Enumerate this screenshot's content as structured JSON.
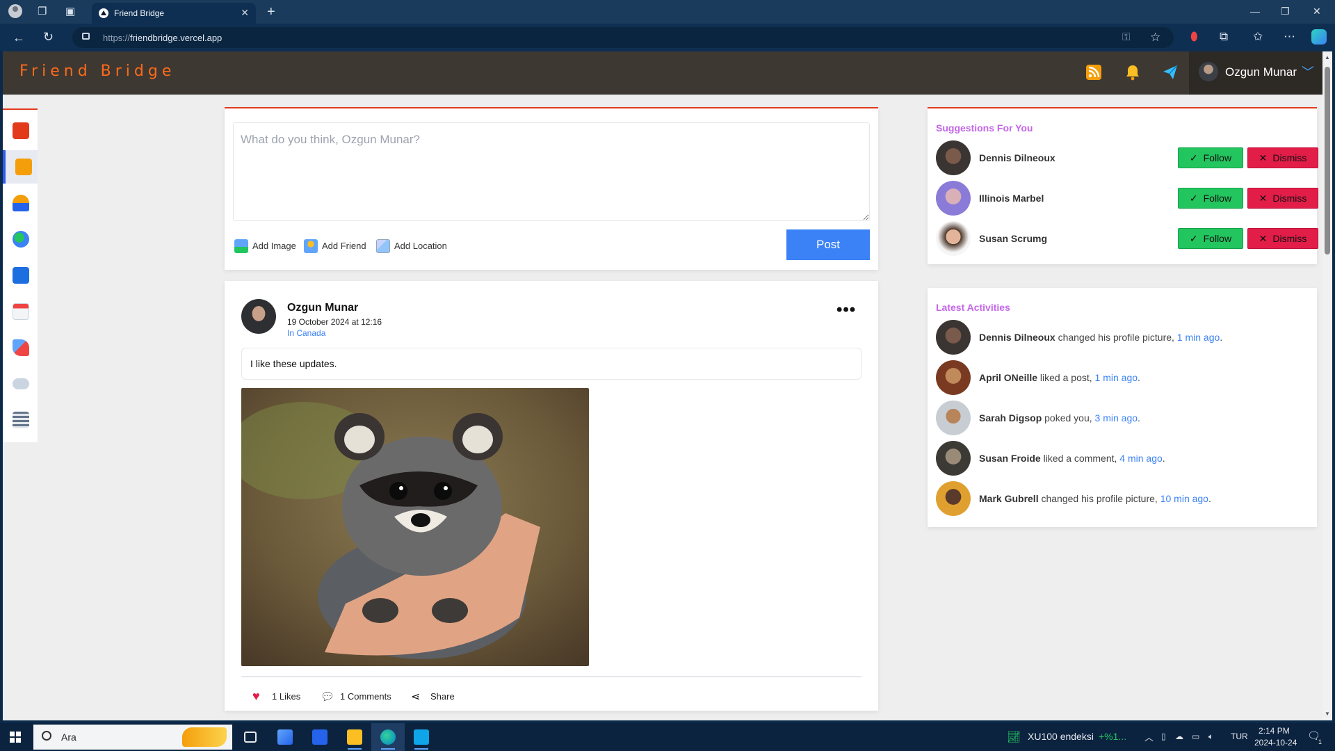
{
  "browser": {
    "tab_title": "Friend Bridge",
    "url_prefix": "https://",
    "url_host": "friendbridge.vercel.app"
  },
  "app": {
    "brand": "Friend Bridge",
    "user_name": "Ozgun Munar"
  },
  "composer": {
    "placeholder": "What do you think, Ozgun Munar?",
    "actions": [
      "Add Image",
      "Add Friend",
      "Add Location"
    ],
    "post_label": "Post"
  },
  "post": {
    "author": "Ozgun Munar",
    "date": "19 October 2024 at 12:16",
    "location": "In Canada",
    "text": "I like these updates.",
    "likes": "1 Likes",
    "comments": "1 Comments",
    "share": "Share",
    "more": "•••"
  },
  "suggestions": {
    "title": "Suggestions For You",
    "follow_label": "Follow",
    "dismiss_label": "Dismiss",
    "people": [
      "Dennis Dilneoux",
      "Illinois Marbel",
      "Susan Scrumg"
    ]
  },
  "latest": {
    "title": "Latest Activities",
    "items": [
      {
        "name": "Dennis Dilneoux",
        "action": " changed his profile picture, ",
        "time": "1 min ago",
        "end": "."
      },
      {
        "name": "April ONeille",
        "action": " liked a post, ",
        "time": "1 min ago",
        "end": "."
      },
      {
        "name": "Sarah Digsop",
        "action": " poked you, ",
        "time": "3 min ago",
        "end": "."
      },
      {
        "name": "Susan Froide",
        "action": " liked a comment, ",
        "time": "4 min ago",
        "end": "."
      },
      {
        "name": "Mark Gubrell",
        "action": " changed his profile picture, ",
        "time": "10 min ago",
        "end": "."
      }
    ]
  },
  "taskbar": {
    "search_placeholder": "Ara",
    "stock_name": "XU100 endeksi",
    "stock_change": "+%1...",
    "lang": "TUR",
    "time": "2:14 PM",
    "date": "2024-10-24",
    "notif_count": "1"
  },
  "colors": {
    "accent_red": "#e23b1c",
    "brand_orange": "#ff6a1a",
    "follow_green": "#22c55e",
    "dismiss_red": "#e11d48",
    "link_blue": "#3b82f6",
    "section_title_purple": "#c466e8"
  }
}
